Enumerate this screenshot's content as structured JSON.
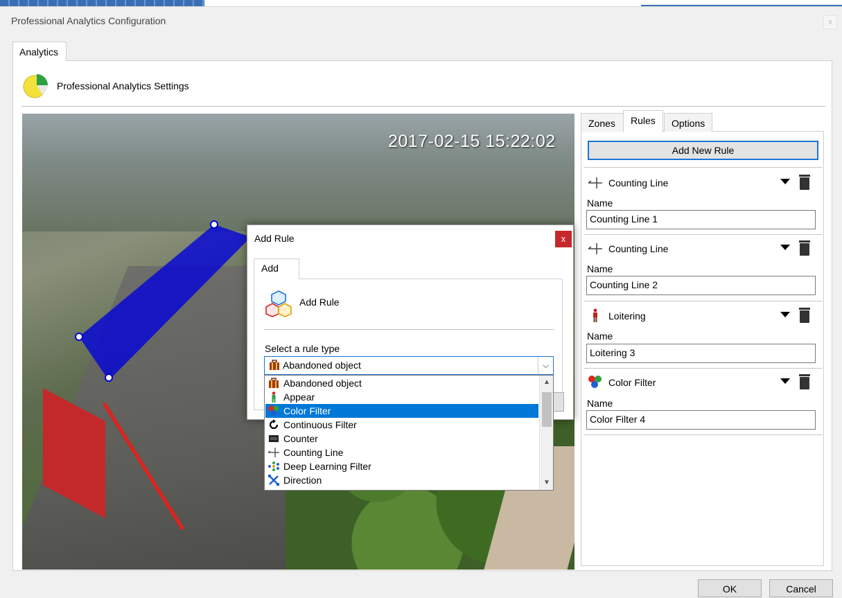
{
  "window": {
    "title": "Professional Analytics Configuration",
    "close_label": "x"
  },
  "main_tab": {
    "label": "Analytics"
  },
  "settings": {
    "title": "Professional Analytics Settings"
  },
  "camera": {
    "timestamp": "2017-02-15 15:22:02"
  },
  "right_panel": {
    "tabs": [
      {
        "label": "Zones"
      },
      {
        "label": "Rules"
      },
      {
        "label": "Options"
      }
    ],
    "add_button_label": "Add New Rule",
    "name_label": "Name",
    "rules": [
      {
        "type": "Counting Line",
        "name": "Counting Line 1",
        "icon": "counting-line-icon"
      },
      {
        "type": "Counting Line",
        "name": "Counting Line 2",
        "icon": "counting-line-icon"
      },
      {
        "type": "Loitering",
        "name": "Loitering 3",
        "icon": "loitering-person-icon"
      },
      {
        "type": "Color Filter",
        "name": "Color Filter 4",
        "icon": "color-filter-icon"
      }
    ]
  },
  "dialog": {
    "title": "Add Rule",
    "close_label": "x",
    "tab_label": "Add",
    "heading": "Add Rule",
    "select_label": "Select a rule type",
    "selected_value": "Abandoned object",
    "options": [
      {
        "label": "Abandoned object",
        "icon": "briefcase-icon"
      },
      {
        "label": "Appear",
        "icon": "appear-person-icon"
      },
      {
        "label": "Color Filter",
        "icon": "color-filter-icon",
        "highlighted": true
      },
      {
        "label": "Continuous Filter",
        "icon": "refresh-icon"
      },
      {
        "label": "Counter",
        "icon": "counter-icon"
      },
      {
        "label": "Counting Line",
        "icon": "counting-line-icon"
      },
      {
        "label": "Deep Learning Filter",
        "icon": "network-icon"
      },
      {
        "label": "Direction",
        "icon": "direction-arrows-icon"
      }
    ]
  },
  "footer": {
    "ok_label": "OK",
    "cancel_label": "Cancel"
  },
  "colors": {
    "accent": "#1e74d3",
    "selection": "#0078d7",
    "zone_fill": "#0000dc",
    "close_red": "#c6282b"
  }
}
